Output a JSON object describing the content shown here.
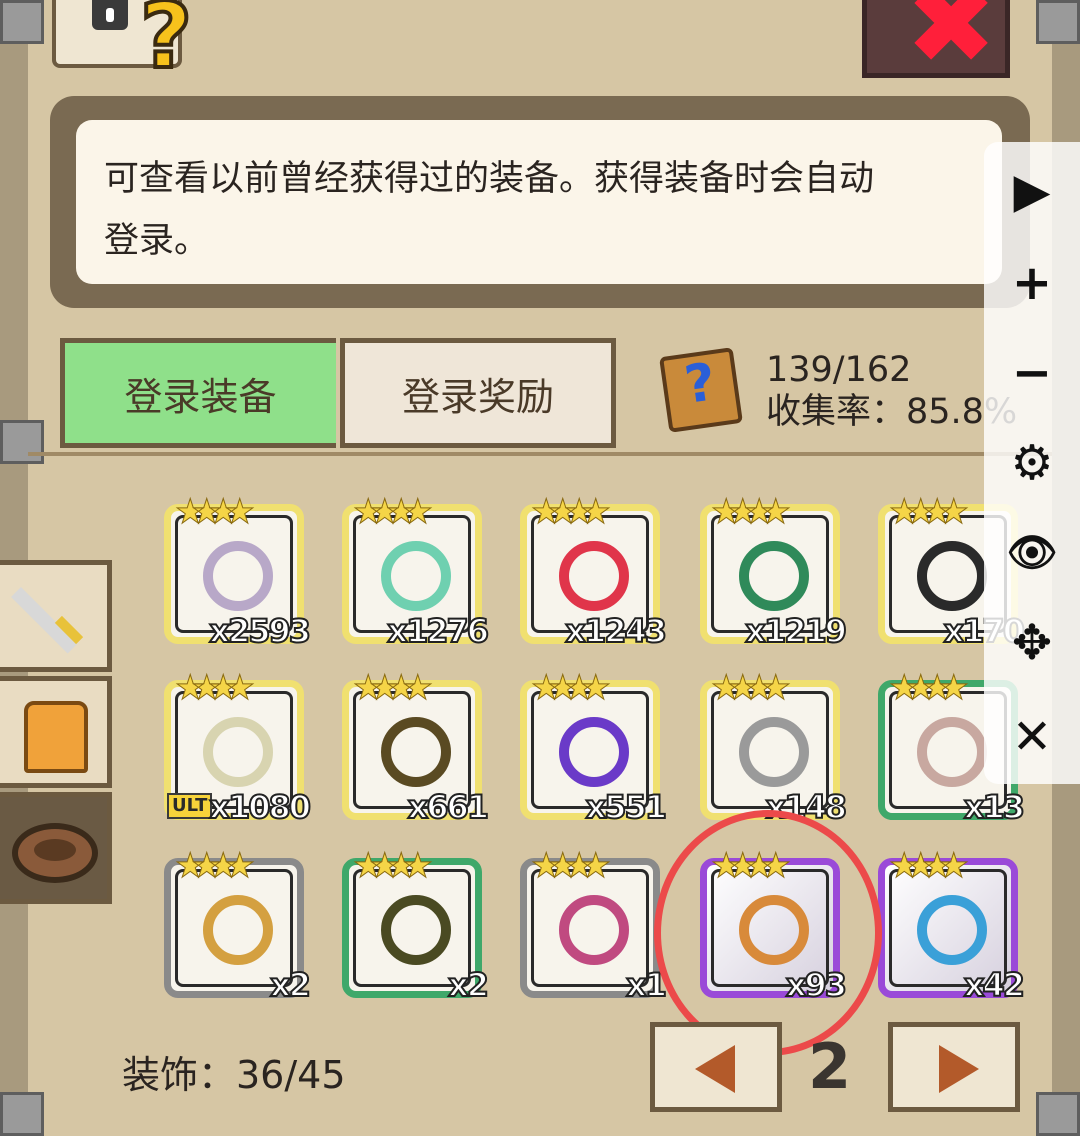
{
  "info": {
    "line1": "可查看以前曾经获得过的装备。获得装备时会自动",
    "line2": "登录。"
  },
  "tabs": {
    "equip": "登录装备",
    "reward": "登录奖励"
  },
  "collection": {
    "count": "139/162",
    "rate": "收集率：85.8%"
  },
  "items": [
    {
      "qty": "x2593",
      "rarity": "gold",
      "art": "#b8a8c8"
    },
    {
      "qty": "x1276",
      "rarity": "gold",
      "art": "#6fd0b0"
    },
    {
      "qty": "x1243",
      "rarity": "gold",
      "art": "#e0354a"
    },
    {
      "qty": "x1219",
      "rarity": "gold",
      "art": "#2f8a5a"
    },
    {
      "qty": "x170",
      "rarity": "gold",
      "art": "#2a2a2a"
    },
    {
      "qty": "x1080",
      "rarity": "gold",
      "art": "#d8d4b0",
      "ult": "ULT"
    },
    {
      "qty": "x661",
      "rarity": "gold",
      "art": "#5a4a22"
    },
    {
      "qty": "x551",
      "rarity": "gold",
      "art": "#6a3ac8"
    },
    {
      "qty": "x148",
      "rarity": "gold",
      "art": "#9a9a9a"
    },
    {
      "qty": "x13",
      "rarity": "green",
      "art": "#c8a8a0"
    },
    {
      "qty": "x2",
      "rarity": "gray",
      "art": "#d4a040"
    },
    {
      "qty": "x2",
      "rarity": "green",
      "art": "#4a4a22"
    },
    {
      "qty": "x1",
      "rarity": "gray",
      "art": "#c04a80"
    },
    {
      "qty": "x93",
      "rarity": "purple",
      "art": "#d88a3a"
    },
    {
      "qty": "x42",
      "rarity": "purple",
      "art": "#3aa0d8"
    }
  ],
  "stars": "★★★★",
  "footer": {
    "category_count": "装饰：36/45",
    "page": "2"
  },
  "toolbar": {
    "play": "▶",
    "zoom_in": "+",
    "zoom_out": "−",
    "settings": "⚙",
    "view": "👁",
    "move": "✥",
    "close": "✕"
  }
}
